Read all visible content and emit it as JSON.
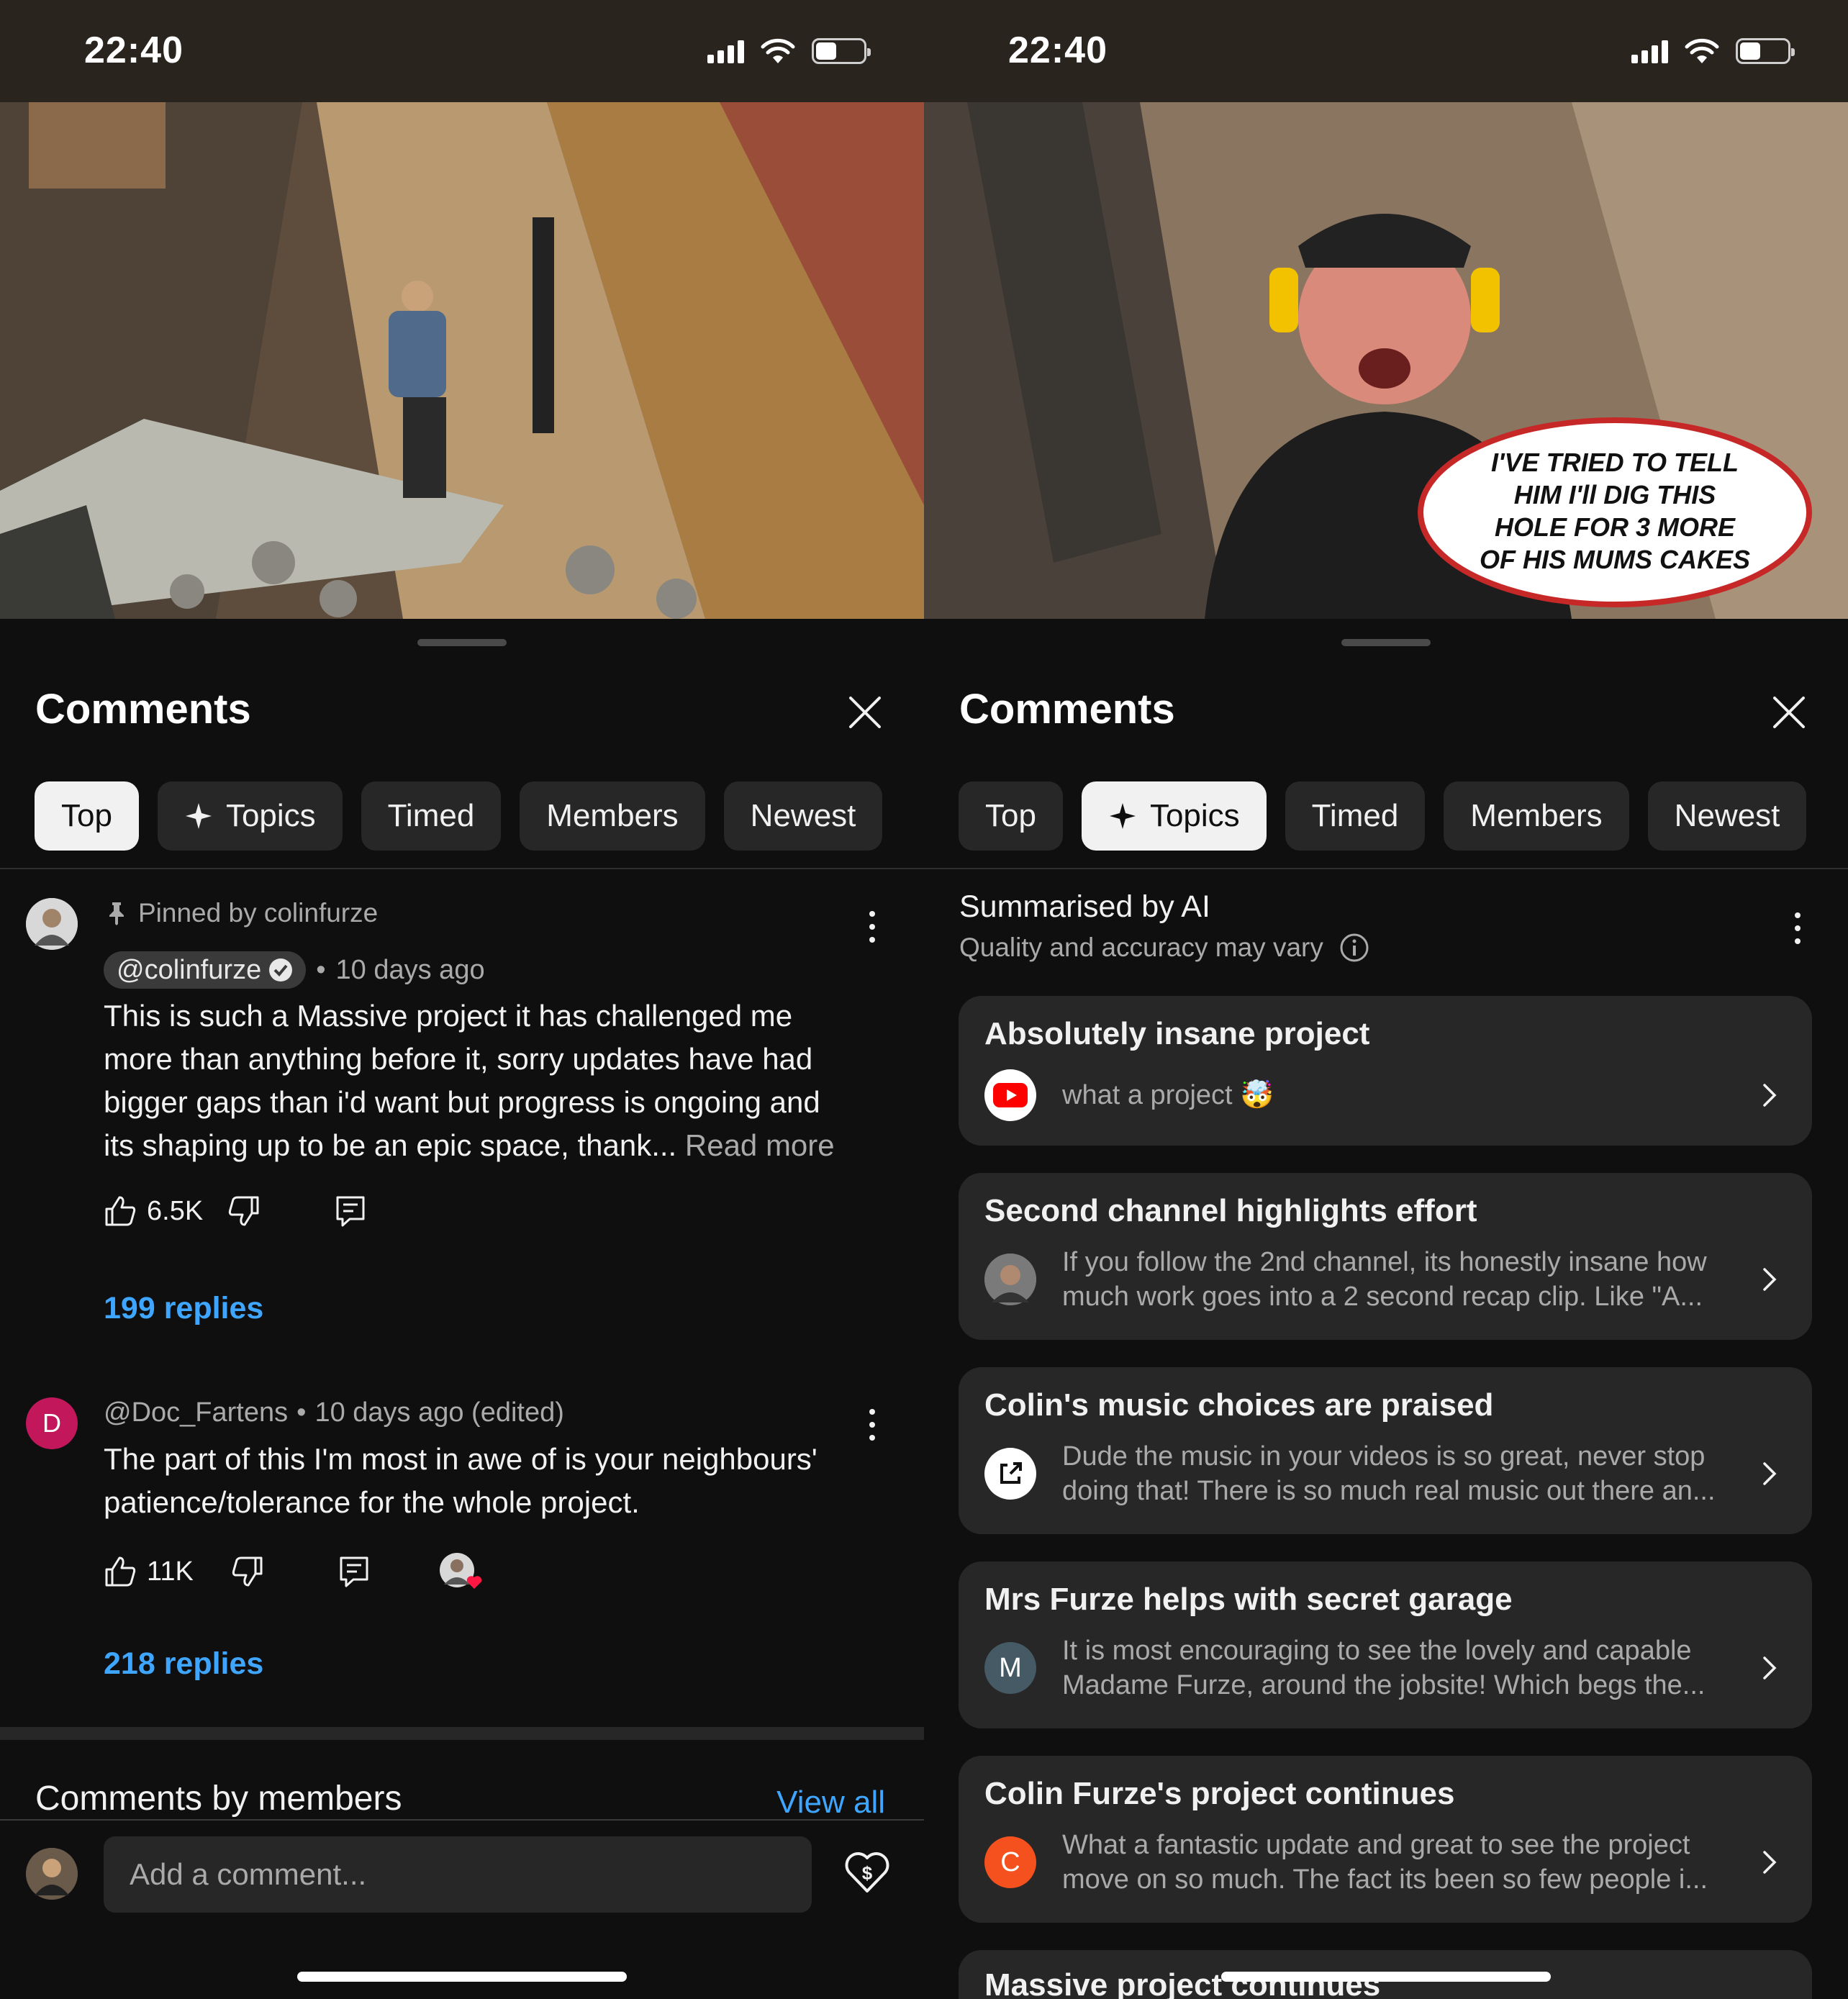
{
  "left": {
    "status": {
      "time": "22:40"
    },
    "sheet_title": "Comments",
    "chips": [
      {
        "label": "Top",
        "active": true
      },
      {
        "label": "Topics",
        "active": false
      },
      {
        "label": "Timed",
        "active": false
      },
      {
        "label": "Members",
        "active": false
      },
      {
        "label": "Newest",
        "active": false
      }
    ],
    "comments": [
      {
        "pinned_label": "Pinned by colinfurze",
        "author": "@colinfurze",
        "age": "10 days ago",
        "lines": [
          "This is such a Massive project it has challenged me",
          "more than anything before it, sorry updates have had",
          "bigger gaps than i'd want but progress is ongoing and",
          "its shaping up to be an epic space, thank..."
        ],
        "read_more": "Read more",
        "likes": "6.5K",
        "replies": "199 replies"
      },
      {
        "author_line": "@Doc_Fartens",
        "age": "10 days ago (edited)",
        "avatar_letter": "D",
        "lines": [
          "The part of this I'm most in awe of is your neighbours'",
          "patience/tolerance for the whole project."
        ],
        "likes": "11K",
        "replies": "218 replies"
      }
    ],
    "members_section": {
      "title": "Comments by members",
      "view_all": "View all"
    },
    "add_comment": {
      "placeholder": "Add a comment..."
    }
  },
  "right": {
    "status": {
      "time": "22:40"
    },
    "sheet_title": "Comments",
    "video_caption": [
      "I'VE TRIED TO  TELL",
      "HIM I'll DIG THIS",
      "HOLE FOR 3 MORE",
      "OF HIS MUMS CAKES"
    ],
    "chips": [
      {
        "label": "Top",
        "active": false
      },
      {
        "label": "Topics",
        "active": true
      },
      {
        "label": "Timed",
        "active": false
      },
      {
        "label": "Members",
        "active": false
      },
      {
        "label": "Newest",
        "active": false
      }
    ],
    "ai": {
      "title": "Summarised by AI",
      "subtitle": "Quality and accuracy may vary"
    },
    "topics": [
      {
        "title": "Absolutely insane project",
        "text": [
          "what a project 🤯"
        ],
        "icon": "youtube-icon"
      },
      {
        "title": "Second channel highlights effort",
        "text": [
          "If you follow the 2nd channel, its honestly insane how",
          "much work goes into a 2 second recap clip. Like \"A..."
        ],
        "icon": "user-photo-avatar"
      },
      {
        "title": "Colin's music choices are praised",
        "text": [
          "Dude the music in your videos is so great, never stop",
          "doing that! There is so much real music out there an..."
        ],
        "icon": "external-link-icon"
      },
      {
        "title": "Mrs Furze helps with secret garage",
        "text": [
          "It is most encouraging to see the lovely and capable",
          "Madame Furze, around the jobsite! Which begs the..."
        ],
        "icon": "letter-avatar",
        "letter": "M"
      },
      {
        "title": "Colin Furze's project continues",
        "text": [
          "What a fantastic update and great to see the project",
          "move on so much. The fact its been so few people i..."
        ],
        "icon": "letter-avatar",
        "letter": "C"
      },
      {
        "title": "Massive project continues",
        "text": [],
        "icon": ""
      }
    ]
  },
  "colors": {
    "accent_link": "#3ea6ff",
    "chip_bg": "#272727",
    "youtube_red": "#ff0000",
    "avatar_pink": "#c2185b",
    "avatar_orange": "#f4511e",
    "avatar_slate": "#455a64"
  }
}
